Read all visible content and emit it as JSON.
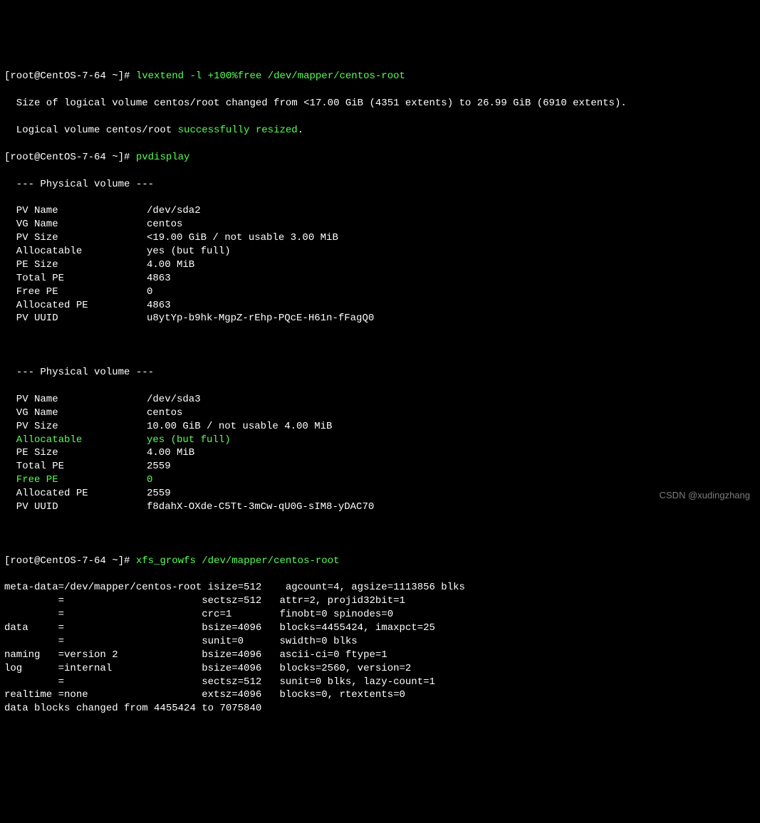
{
  "prompt": {
    "text": "[root@CentOS-7-64 ~]#"
  },
  "cmd1": "lvextend -l +100%free /dev/mapper/centos-root",
  "cmd1_out": {
    "line1": "  Size of logical volume centos/root changed from <17.00 GiB (4351 extents) to 26.99 GiB (6910 extents).",
    "line2a": "  Logical volume centos/root ",
    "line2b": "successfully resized",
    "line2c": "."
  },
  "cmd2": "pvdisplay",
  "pv1": {
    "header": "  --- Physical volume ---",
    "rows": [
      {
        "k": "  PV Name",
        "v": "/dev/sda2"
      },
      {
        "k": "  VG Name",
        "v": "centos"
      },
      {
        "k": "  PV Size",
        "v": "<19.00 GiB / not usable 3.00 MiB"
      },
      {
        "k": "  Allocatable",
        "v": "yes (but full)"
      },
      {
        "k": "  PE Size",
        "v": "4.00 MiB"
      },
      {
        "k": "  Total PE",
        "v": "4863"
      },
      {
        "k": "  Free PE",
        "v": "0"
      },
      {
        "k": "  Allocated PE",
        "v": "4863"
      },
      {
        "k": "  PV UUID",
        "v": "u8ytYp-b9hk-MgpZ-rEhp-PQcE-H61n-fFagQ0"
      }
    ]
  },
  "pv2": {
    "header": "  --- Physical volume ---",
    "rows": [
      {
        "k": "  PV Name",
        "v": "/dev/sda3",
        "hl": false
      },
      {
        "k": "  VG Name",
        "v": "centos",
        "hl": false
      },
      {
        "k": "  PV Size",
        "v": "10.00 GiB / not usable 4.00 MiB",
        "hl": false
      },
      {
        "k": "  Allocatable",
        "v": "yes (but full)",
        "hl": true
      },
      {
        "k": "  PE Size",
        "v": "4.00 MiB",
        "hl": false
      },
      {
        "k": "  Total PE",
        "v": "2559",
        "hl": false
      },
      {
        "k": "  Free PE",
        "v": "0",
        "hl": true
      },
      {
        "k": "  Allocated PE",
        "v": "2559",
        "hl": false
      },
      {
        "k": "  PV UUID",
        "v": "f8dahX-OXde-C5Tt-3mCw-qU0G-sIM8-yDAC70",
        "hl": false
      }
    ]
  },
  "cmd3": "xfs_growfs /dev/mapper/centos-root",
  "growfs": [
    "meta-data=/dev/mapper/centos-root isize=512    agcount=4, agsize=1113856 blks",
    "         =                       sectsz=512   attr=2, projid32bit=1",
    "         =                       crc=1        finobt=0 spinodes=0",
    "data     =                       bsize=4096   blocks=4455424, imaxpct=25",
    "         =                       sunit=0      swidth=0 blks",
    "naming   =version 2              bsize=4096   ascii-ci=0 ftype=1",
    "log      =internal               bsize=4096   blocks=2560, version=2",
    "         =                       sectsz=512   sunit=0 blks, lazy-count=1",
    "realtime =none                   extsz=4096   blocks=0, rtextents=0",
    "data blocks changed from 4455424 to 7075840"
  ],
  "watermark": "CSDN @xudingzhang"
}
